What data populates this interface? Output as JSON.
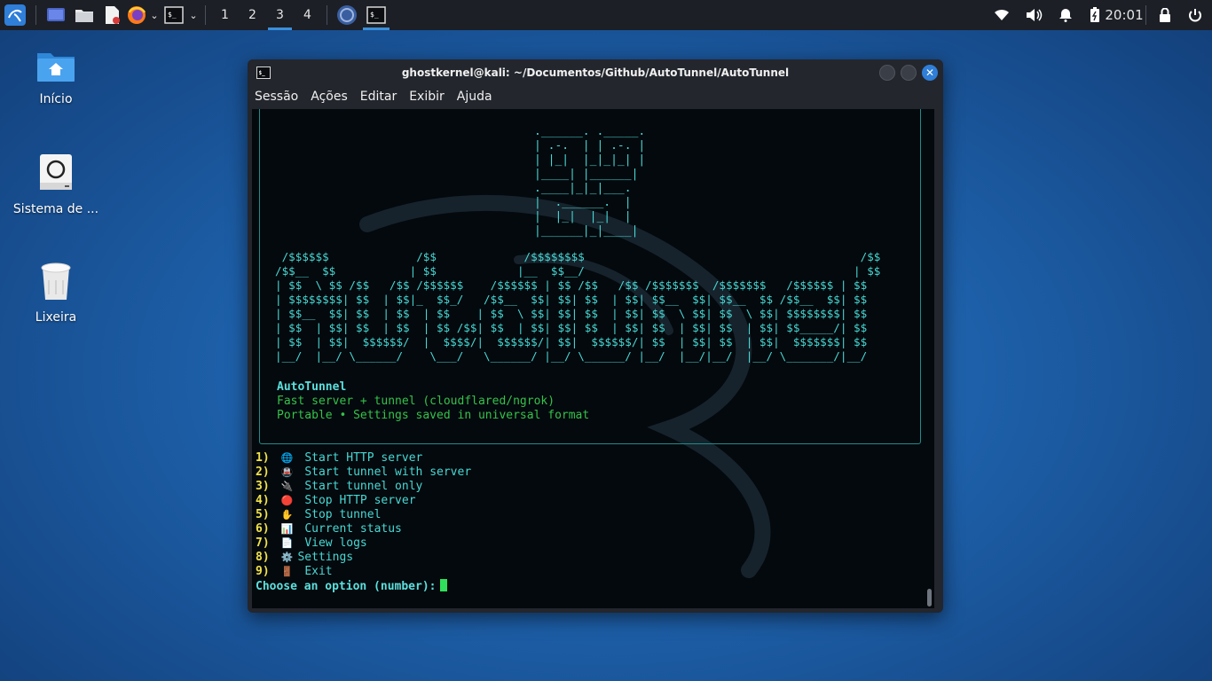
{
  "panel": {
    "workspaces": [
      "1",
      "2",
      "3",
      "4"
    ],
    "active_workspace": "3",
    "clock": "20:01",
    "icons": [
      "kali-menu-icon",
      "desktop-icon",
      "file-manager-icon",
      "text-editor-icon",
      "firefox-icon",
      "terminal-icon"
    ]
  },
  "desktop": {
    "icons": [
      {
        "label": "Início",
        "icon": "home-folder-icon"
      },
      {
        "label": "Sistema de ...",
        "icon": "filesystem-icon"
      },
      {
        "label": "Lixeira",
        "icon": "trash-icon"
      }
    ]
  },
  "window": {
    "title": "ghostkernel@kali: ~/Documentos/Github/AutoTunnel/AutoTunnel",
    "menu": [
      "Sessão",
      "Ações",
      "Editar",
      "Exibir",
      "Ajuda"
    ]
  },
  "terminal": {
    "logo_art": ".______. ._____.\n| .-.  | | .-. |\n| |_|  |_|_|_| |\n|____| |______|\n.____|_|_|___.\n|  .______.  |\n|  |_|  |_|  |\n|______|_|____|",
    "banner_art": " /$$$$$$             /$$             /$$$$$$$$                                         /$$\n/$$__  $$           | $$            |__  $$__/                                        | $$\n| $$  \\ $$ /$$   /$$ /$$$$$$    /$$$$$$ | $$ /$$   /$$ /$$$$$$$  /$$$$$$$   /$$$$$$ | $$\n| $$$$$$$$| $$  | $$|_  $$_/   /$$__  $$| $$| $$  | $$| $$__  $$| $$__  $$ /$$__  $$| $$\n| $$__  $$| $$  | $$  | $$    | $$  \\ $$| $$| $$  | $$| $$  \\ $$| $$  \\ $$| $$$$$$$$| $$\n| $$  | $$| $$  | $$  | $$ /$$| $$  | $$| $$| $$  | $$| $$  | $$| $$  | $$| $$_____/| $$\n| $$  | $$|  $$$$$$/  |  $$$$/|  $$$$$$/| $$|  $$$$$$/| $$  | $$| $$  | $$|  $$$$$$$| $$\n|__/  |__/ \\______/    \\___/   \\______/ |__/ \\______/ |__/  |__/|__/  |__/ \\_______/|__/",
    "app_name": "AutoTunnel",
    "tagline": "Fast server + tunnel (cloudflared/ngrok)",
    "subtitle": "Portable • Settings saved in universal format",
    "options": [
      {
        "num": "1)",
        "emoji": "🌐",
        "label": "Start HTTP server"
      },
      {
        "num": "2)",
        "emoji": "🚇",
        "label": "Start tunnel with server"
      },
      {
        "num": "3)",
        "emoji": "🔌",
        "label": "Start tunnel only"
      },
      {
        "num": "4)",
        "emoji": "🔴",
        "label": "Stop HTTP server"
      },
      {
        "num": "5)",
        "emoji": "✋",
        "label": "Stop tunnel"
      },
      {
        "num": "6)",
        "emoji": "📊",
        "label": "Current status"
      },
      {
        "num": "7)",
        "emoji": "📄",
        "label": "View logs"
      },
      {
        "num": "8)",
        "emoji": "⚙️",
        "label": "Settings"
      },
      {
        "num": "9)",
        "emoji": "🚪",
        "label": "Exit"
      }
    ],
    "prompt": "Choose an option (number):"
  },
  "colors": {
    "cyan": "#48d8d4",
    "green": "#35c24a",
    "yellow": "#f2e34a",
    "accent": "#2f7ed8"
  }
}
